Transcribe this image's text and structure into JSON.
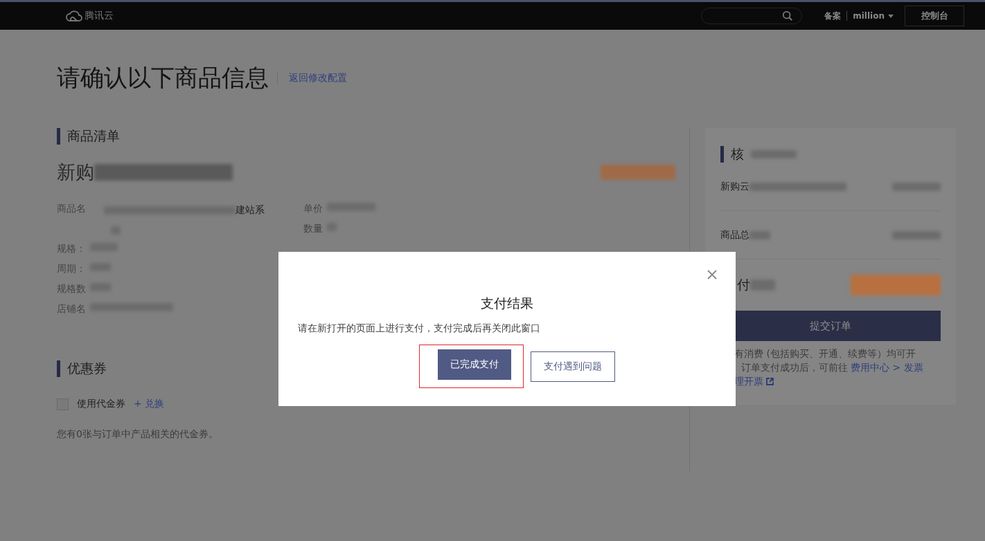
{
  "header": {
    "logo": "腾讯云",
    "links": [
      "备案"
    ],
    "user": "million",
    "console_button": "控制台"
  },
  "page": {
    "title": "请确认以下商品信息",
    "back_link": "返回修改配置"
  },
  "product_list": {
    "heading": "商品清单",
    "product_title": "新购",
    "details_left": [
      {
        "label": "商品名",
        "value": "建站系"
      },
      {
        "label": "规格："
      },
      {
        "label": "周期："
      },
      {
        "label": "规格数"
      },
      {
        "label": "店铺名"
      }
    ],
    "details_right": [
      {
        "label": "单价"
      },
      {
        "label": "数量"
      }
    ]
  },
  "coupon": {
    "heading": "优惠券",
    "checkbox": {
      "label": "使用代金券",
      "checked": false
    },
    "exchange_link": "+ 兑换",
    "note": "您有0张与订单中产品相关的代金券。"
  },
  "order_summary": {
    "heading": "核",
    "rows": [
      {
        "label": "新购云"
      },
      {
        "label": "商品总"
      }
    ],
    "pay_label": "付",
    "submit_button": "提交订单",
    "note_line_1": "有消费 (包括购买、开通、续费等）均可开",
    "note_line_2": "订单支付成功后，可前往",
    "note_link": "费用中心 > 发票",
    "note_link_2": "理开票"
  },
  "dialog": {
    "title": "支付结果",
    "message": "请在新打开的页面上进行支付，支付完成后再关闭此窗口",
    "buttons": [
      {
        "label": "已完成支付",
        "kind": "primary",
        "highlighted": true
      },
      {
        "label": "支付遇到问题",
        "kind": "secondary",
        "highlighted": false
      }
    ]
  }
}
